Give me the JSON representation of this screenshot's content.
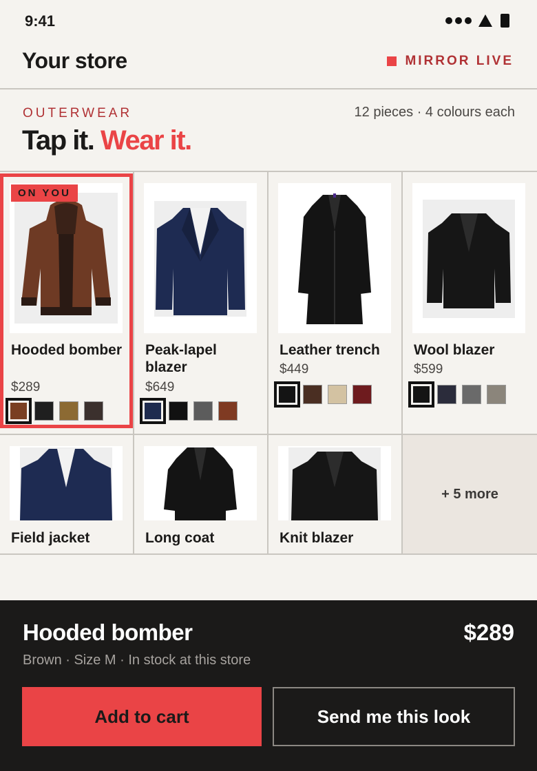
{
  "status": {
    "time": "9:41"
  },
  "header": {
    "title": "Your store",
    "live_label": "MIRROR LIVE"
  },
  "section": {
    "category": "OUTERWEAR",
    "count": "12 pieces · 4 colours each",
    "headline_1": "Tap it.",
    "headline_2": "Wear it."
  },
  "badge": "ON YOU",
  "products": [
    {
      "name": "Hooded bomber",
      "price": "$289",
      "icon": "brown-leather-bomber-jacket",
      "swatches": [
        "#7a3f22",
        "#1f1f1f",
        "#8c6a33",
        "#3b302d"
      ],
      "active": 0
    },
    {
      "name": "Peak-lapel blazer",
      "price": "$649",
      "icon": "navy-blazer",
      "swatches": [
        "#1e2b4f",
        "#111111",
        "#5c5c5c",
        "#7f3a22"
      ],
      "active": 0
    },
    {
      "name": "Leather trench",
      "price": "$449",
      "icon": "black-leather-trench-coat",
      "swatches": [
        "#141414",
        "#4a2e22",
        "#d3c2a2",
        "#6e1b1e"
      ],
      "active": 0
    },
    {
      "name": "Wool blazer",
      "price": "$599",
      "icon": "black-wool-blazer",
      "swatches": [
        "#141414",
        "#2b2c3b",
        "#6a6a6a",
        "#8b857b"
      ],
      "active": 0
    },
    {
      "name": "Field jacket",
      "icon": "navy-jacket"
    },
    {
      "name": "Long coat",
      "icon": "black-long-coat"
    },
    {
      "name": "Knit blazer",
      "icon": "black-knit-blazer"
    }
  ],
  "more_label": "+ 5 more",
  "selection": {
    "title": "Hooded bomber",
    "price": "$289",
    "meta": "Brown · Size M · In stock at this store",
    "add_label": "Add to cart",
    "send_label": "Send me this look"
  },
  "colors": {
    "accent": "#ea4446",
    "dark": "#1b1a19",
    "background": "#f5f3ef"
  }
}
